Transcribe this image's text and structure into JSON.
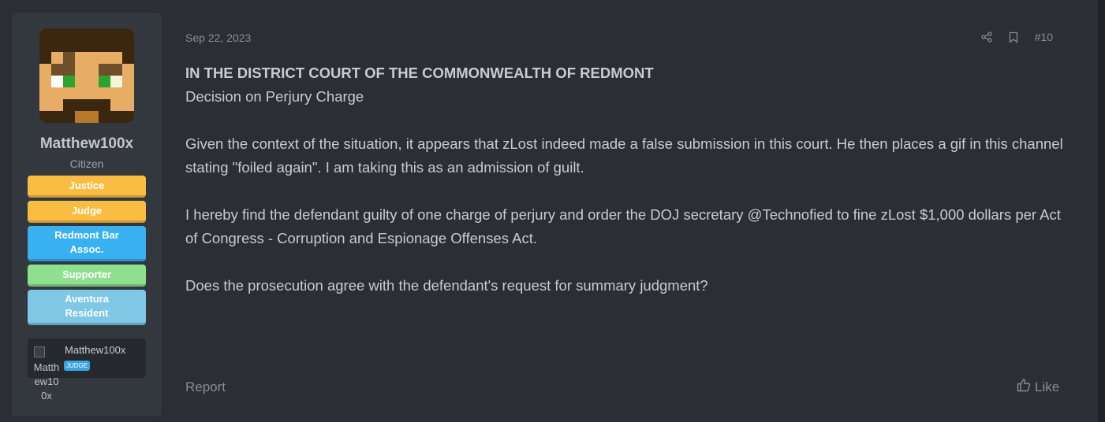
{
  "user": {
    "name": "Matthew100x",
    "title": "Citizen",
    "banners": [
      "Justice",
      "Judge",
      "Redmont Bar Assoc.",
      "Supporter",
      "Aventura Resident"
    ],
    "linked_image_alt": "Matthew100x",
    "linked_name": "Matthew100x",
    "linked_badge": "JUDGE"
  },
  "post": {
    "date": "Sep 22, 2023",
    "number": "#10",
    "heading": "IN THE DISTRICT COURT OF THE COMMONWEALTH OF REDMONT",
    "subheading": "Decision on Perjury Charge",
    "paragraphs": [
      "Given the context of the situation, it appears that zLost indeed made a false submission in this court. He then places a gif in this channel stating \"foiled again\". I am taking this as an admission of guilt.",
      "I hereby find the defendant guilty of one charge of perjury and order the DOJ secretary @Technofied to fine zLost $1,000 dollars per Act of Congress - Corruption and Espionage Offenses Act.",
      "Does the prosecution agree with the defendant's request for summary judgment?"
    ],
    "report_label": "Report",
    "like_label": "Like"
  },
  "icons": {
    "share": "share-icon",
    "bookmark": "bookmark-icon",
    "like": "thumbs-up-icon"
  }
}
